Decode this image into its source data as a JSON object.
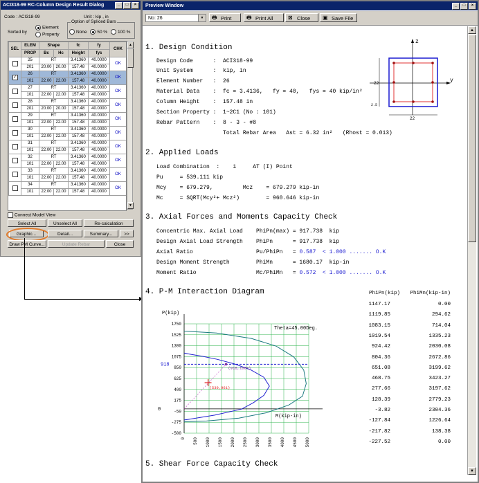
{
  "dialog": {
    "title": "ACI318-99 RC-Column Design Result Dialog",
    "code_label": "Code : ACI318-99",
    "unit_label": "Unit : kip , in",
    "sorted_by_label": "Sorted by",
    "sort_element": "Element",
    "sort_property": "Property",
    "splice_group_label": "Option of Spliced Bars",
    "splice_none": "None",
    "splice_50": "50 %",
    "splice_100": "100 %",
    "headers": {
      "sel": "SEL",
      "elem": "ELEM",
      "prop": "PROP",
      "shape": "Shape",
      "bc": "Bc",
      "hc": "Hc",
      "fc": "fc",
      "height": "Height",
      "fy": "fy",
      "fys": "fys",
      "chk": "CHK"
    },
    "rows": [
      {
        "elem": "25",
        "prop": "201",
        "shape": "RT",
        "bc": "20.00",
        "hc": "20.00",
        "fc": "3.41360",
        "height": "157.48",
        "fy": "40.0000",
        "fys": "40.0000",
        "chk": "OK",
        "checked": false
      },
      {
        "elem": "26",
        "prop": "101",
        "shape": "RT",
        "bc": "22.00",
        "hc": "22.00",
        "fc": "3.41360",
        "height": "157.48",
        "fy": "40.0000",
        "fys": "40.0000",
        "chk": "OK",
        "checked": true
      },
      {
        "elem": "27",
        "prop": "101",
        "shape": "RT",
        "bc": "22.00",
        "hc": "22.00",
        "fc": "3.41360",
        "height": "157.48",
        "fy": "40.0000",
        "fys": "40.0000",
        "chk": "OK",
        "checked": false
      },
      {
        "elem": "28",
        "prop": "201",
        "shape": "RT",
        "bc": "20.00",
        "hc": "20.00",
        "fc": "3.41360",
        "height": "157.48",
        "fy": "40.0000",
        "fys": "40.0000",
        "chk": "OK",
        "checked": false
      },
      {
        "elem": "29",
        "prop": "101",
        "shape": "RT",
        "bc": "22.00",
        "hc": "22.00",
        "fc": "3.41360",
        "height": "157.48",
        "fy": "40.0000",
        "fys": "40.0000",
        "chk": "OK",
        "checked": false
      },
      {
        "elem": "30",
        "prop": "101",
        "shape": "RT",
        "bc": "22.00",
        "hc": "22.00",
        "fc": "3.41360",
        "height": "157.48",
        "fy": "40.0000",
        "fys": "40.0000",
        "chk": "OK",
        "checked": false
      },
      {
        "elem": "31",
        "prop": "101",
        "shape": "RT",
        "bc": "22.00",
        "hc": "22.00",
        "fc": "3.41360",
        "height": "157.48",
        "fy": "40.0000",
        "fys": "40.0000",
        "chk": "OK",
        "checked": false
      },
      {
        "elem": "32",
        "prop": "101",
        "shape": "RT",
        "bc": "22.00",
        "hc": "22.00",
        "fc": "3.41360",
        "height": "157.48",
        "fy": "40.0000",
        "fys": "40.0000",
        "chk": "OK",
        "checked": false
      },
      {
        "elem": "33",
        "prop": "101",
        "shape": "RT",
        "bc": "22.00",
        "hc": "22.00",
        "fc": "3.41360",
        "height": "157.48",
        "fy": "40.0000",
        "fys": "40.0000",
        "chk": "OK",
        "checked": false
      },
      {
        "elem": "34",
        "prop": "101",
        "shape": "RT",
        "bc": "22.00",
        "hc": "22.00",
        "fc": "3.41360",
        "height": "157.48",
        "fy": "40.0000",
        "fys": "40.0000",
        "chk": "OK",
        "checked": false
      }
    ],
    "connect_model_view": "Connect Model View",
    "buttons": {
      "select_all": "Select All",
      "unselect_all": "Unselect All",
      "recalc": "Re-calculation",
      "graphic": "Graphic...",
      "detail": "Detail...",
      "summary": "Summary...",
      "more": ">>",
      "draw_pm": "Draw PM Curve...",
      "update_rebar": "Update Rebar",
      "close": "Close"
    }
  },
  "preview": {
    "title": "Preview Window",
    "combo_value": "No: 26",
    "print": "Print",
    "print_all": "Print All",
    "close": "Close",
    "save_file": "Save File",
    "s1": {
      "heading": "1. Design Condition",
      "lines": [
        "Design Code      :  ACI318-99",
        "Unit System      :  kip, in",
        "Element Number   :  26",
        "Material Data    :  fc = 3.4136,   fy = 40,   fys = 40 kip/in²",
        "Column Height    :  157.48 in",
        "Section Property :  1~2C1 (No : 101)",
        "Rebar Pattern    :  8 - 3 - #8",
        "                    Total Rebar Area   Ast = 6.32 in²   (Rhost = 0.013)"
      ],
      "sec_z": "z",
      "sec_y": "y",
      "sec_dim_h": "22",
      "sec_dim_b": "22",
      "sec_dim_cover": "2.5"
    },
    "s2": {
      "heading": "2. Applied Loads",
      "lines": [
        "Load Combination  :    1     AT (I) Point",
        "Pu     = 539.111 kip",
        "Mcy    = 679.279,         Mcz    = 679.279 kip-in",
        "Mc     = SQRT(Mcy²+ Mcz²)        = 960.646 kip-in"
      ]
    },
    "s3": {
      "heading": "3. Axial Forces and Moments Capacity Check",
      "l1a": "Concentric Max. Axial Load    PhiPn(max) = 917.738  kip",
      "l2a": "Design Axial Load Strength    PhiPn      = 917.738  kip",
      "l3a": "Axial Ratio                   Pu/PhiPn   = ",
      "l3b": "0.587  < 1.000 ....... O.K",
      "l4a": "Design Moment Strength        PhiMn      = 1680.17  kip-in",
      "l5a": "Moment Ratio                  Mc/PhiMn   = ",
      "l5b": "0.572  < 1.000 ....... O.K"
    },
    "s4": {
      "heading": "4. P-M Interaction Diagram",
      "col1": "PhiPn(kip)",
      "col2": "PhiMn(kip-in)",
      "table": [
        [
          "1147.17",
          "0.00"
        ],
        [
          "1119.85",
          "294.62"
        ],
        [
          "1083.15",
          "714.04"
        ],
        [
          "1019.54",
          "1335.23"
        ],
        [
          "924.42",
          "2030.08"
        ],
        [
          "804.36",
          "2672.86"
        ],
        [
          "651.08",
          "3199.62"
        ],
        [
          "468.75",
          "3423.27"
        ],
        [
          "277.66",
          "3197.62"
        ],
        [
          "128.39",
          "2779.23"
        ],
        [
          "-3.82",
          "2304.36"
        ],
        [
          "-127.84",
          "1226.64"
        ],
        [
          "-217.82",
          "138.38"
        ],
        [
          "-227.52",
          "0.00"
        ]
      ]
    },
    "s5": {
      "heading": "5. Shear Force Capacity Check"
    }
  },
  "chart_data": {
    "type": "line",
    "title": "",
    "xlabel": "M(kip-in)",
    "ylabel": "P(kip)",
    "annotation_theta": "Theta=45.00Deg.",
    "xlim": [
      0,
      5000
    ],
    "ylim": [
      -500,
      1750
    ],
    "x_ticks": [
      "0",
      "500",
      "1000",
      "1500",
      "2000",
      "2500",
      "3000",
      "3500",
      "4000",
      "4500",
      "5000"
    ],
    "y_ticks": [
      "1750",
      "1525",
      "1300",
      "1075",
      "850",
      "625",
      "400",
      "175",
      "-50",
      "-275",
      "-500"
    ],
    "phipn_max_label": "918",
    "phipn_max": 918,
    "capacity_point_label": "(918,1680)",
    "load_point_label": "(539,961)",
    "capacity_point": {
      "x": 1680,
      "y": 918
    },
    "load_point": {
      "x": 961,
      "y": 539
    },
    "series": [
      {
        "color": "#1c7a80",
        "x": [
          0,
          1300,
          2700,
          3700,
          4400,
          4800,
          4900,
          4750,
          4200,
          3300,
          2200,
          900,
          0
        ],
        "y": [
          1600,
          1560,
          1450,
          1290,
          1070,
          800,
          520,
          260,
          80,
          -80,
          -190,
          -250,
          -265
        ]
      },
      {
        "color": "#2020d0",
        "x": [
          0,
          294.62,
          714.04,
          1335.23,
          2030.08,
          2672.86,
          3199.62,
          3423.27,
          3197.62,
          2779.23,
          2304.36,
          1226.64,
          138.38,
          0
        ],
        "y": [
          1147.17,
          1119.85,
          1083.15,
          1019.54,
          924.42,
          804.36,
          651.08,
          468.75,
          277.66,
          128.39,
          -3.82,
          -127.84,
          -217.82,
          -227.52
        ]
      }
    ]
  }
}
